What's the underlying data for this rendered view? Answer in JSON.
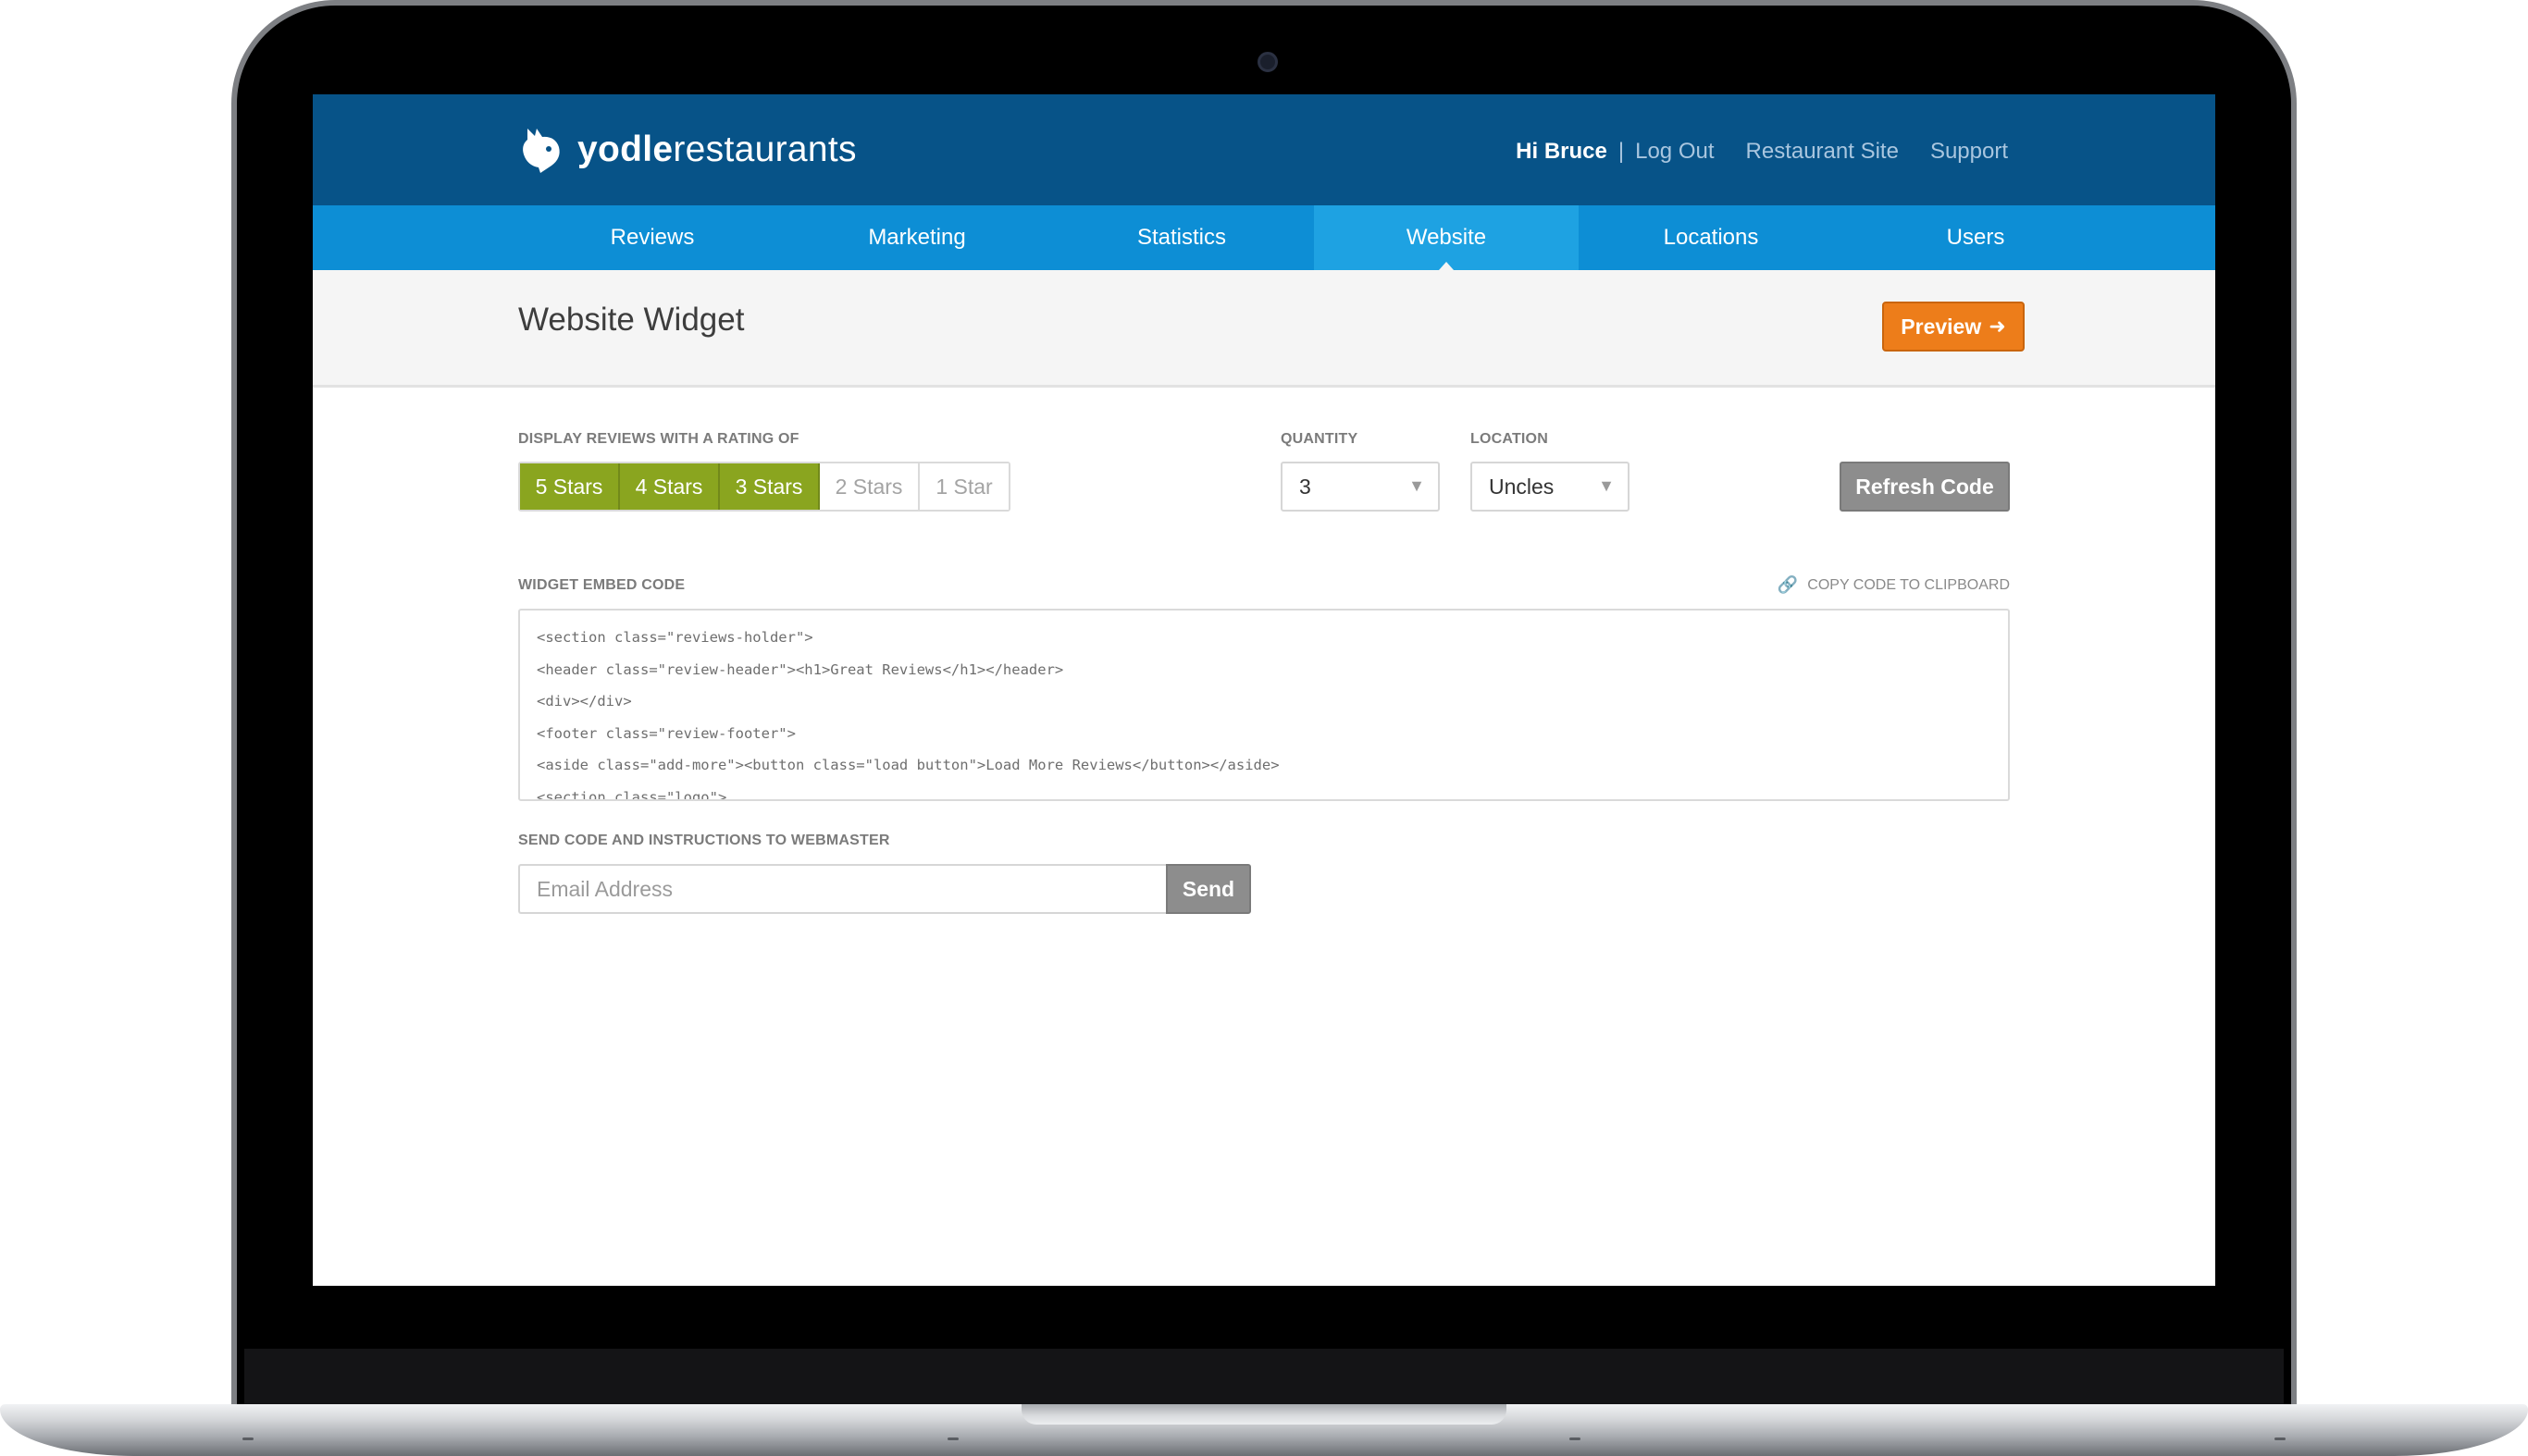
{
  "brand": {
    "name_bold": "yodle",
    "name_light": "restaurants"
  },
  "header": {
    "greeting": "Hi Bruce",
    "separator": "|",
    "links": [
      "Log Out",
      "Restaurant Site",
      "Support"
    ]
  },
  "nav": {
    "tabs": [
      "Reviews",
      "Marketing",
      "Statistics",
      "Website",
      "Locations",
      "Users"
    ],
    "active": "Website"
  },
  "page": {
    "title": "Website Widget",
    "preview_label": "Preview",
    "preview_icon": "arrow-right-icon"
  },
  "rating": {
    "label": "DISPLAY REVIEWS WITH A RATING OF",
    "options": [
      "5 Stars",
      "4 Stars",
      "3 Stars",
      "2 Stars",
      "1 Star"
    ],
    "selected": [
      "5 Stars",
      "4 Stars",
      "3 Stars"
    ],
    "selected_color": "#8aa51f"
  },
  "quantity": {
    "label": "QUANTITY",
    "value": "3"
  },
  "location": {
    "label": "LOCATION",
    "value": "Uncles"
  },
  "refresh_label": "Refresh Code",
  "embed": {
    "label": "WIDGET EMBED CODE",
    "copy_label": "COPY CODE TO CLIPBOARD",
    "lines": [
      "<section class=\"reviews-holder\">",
      "<header class=\"review-header\"><h1>Great Reviews</h1></header>",
      "<div></div>",
      "<footer class=\"review-footer\">",
      "<aside class=\"add-more\"><button class=\"load button\">Load More Reviews</button></aside>",
      "<section class=\"logo\">"
    ]
  },
  "webmaster": {
    "label": "SEND CODE AND INSTRUCTIONS TO WEBMASTER",
    "email_placeholder": "Email Address",
    "send_label": "Send"
  },
  "colors": {
    "header_bg": "#075388",
    "nav_bg": "#0d8ed5",
    "nav_active_bg": "#1ea2e2",
    "preview_bg": "#ed7d1a",
    "button_gray": "#8d8d8d"
  }
}
